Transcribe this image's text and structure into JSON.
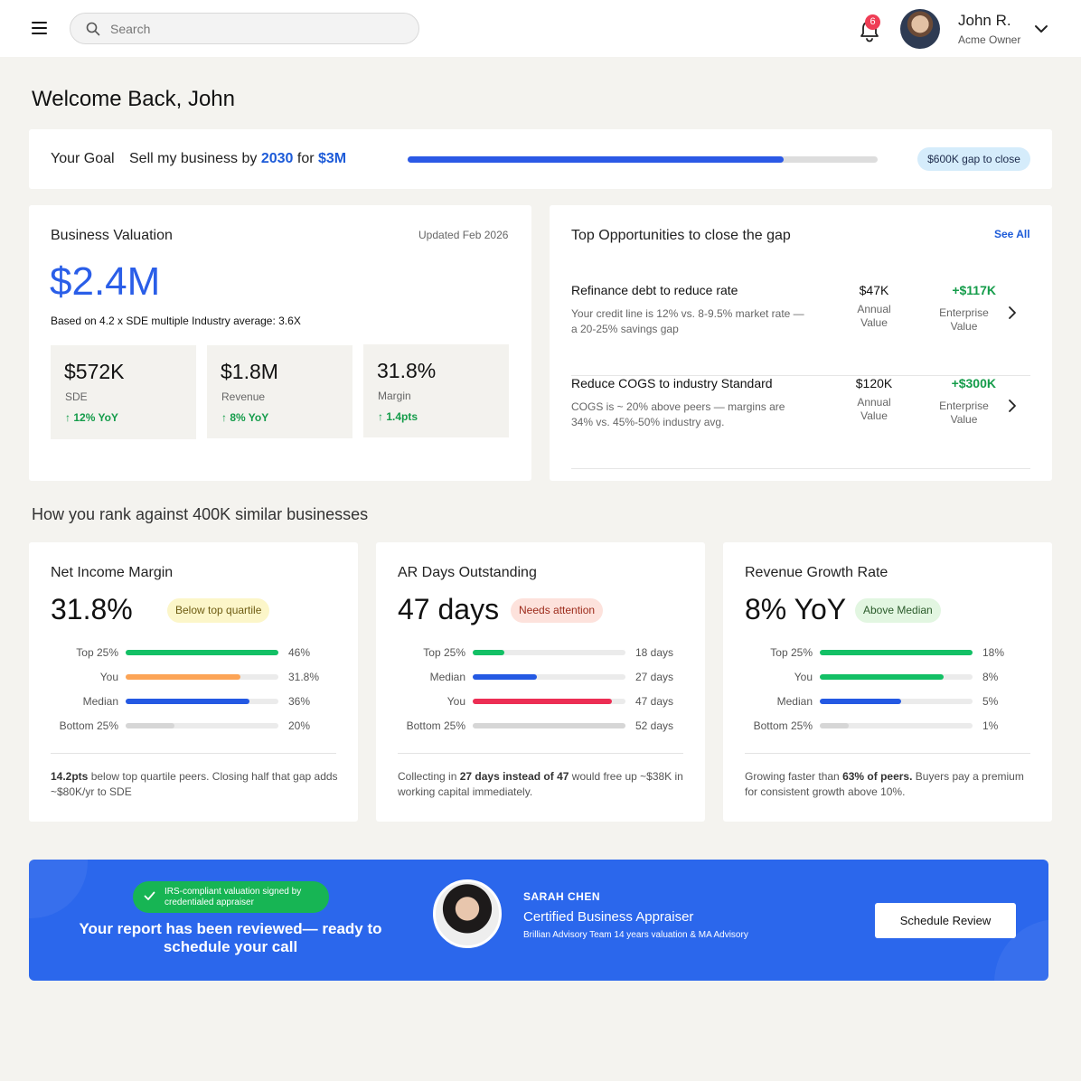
{
  "header": {
    "search_placeholder": "Search",
    "notification_count": "6",
    "user_name": "John R.",
    "user_role": "Acme Owner"
  },
  "welcome": "Welcome Back, John",
  "goal": {
    "label": "Your Goal",
    "text_prefix": "Sell my business by ",
    "year": "2030",
    "text_mid": " for ",
    "amount": "$3M",
    "progress_fraction": 0.8,
    "gap_badge": "$600K gap to close"
  },
  "valuation": {
    "title": "Business Valuation",
    "updated": "Updated Feb 2026",
    "amount": "$2.4M",
    "basis": "Based on 4.2 x SDE multiple Industry average: 3.6X",
    "metrics": [
      {
        "value": "$572K",
        "label": "SDE",
        "change": "12% YoY"
      },
      {
        "value": "$1.8M",
        "label": "Revenue",
        "change": "8% YoY"
      },
      {
        "value": "31.8%",
        "label": "Margin",
        "change": "1.4pts"
      }
    ]
  },
  "opportunities": {
    "title": "Top Opportunities to close the gap",
    "see_all": "See All",
    "items": [
      {
        "title": "Refinance debt to reduce rate",
        "desc": "Your credit line is 12% vs. 8-9.5% market rate — a 20-25% savings gap",
        "annual": "$47K",
        "annual_label": "Annual Value",
        "enterprise": "+$117K",
        "enterprise_label": "Enterprise Value"
      },
      {
        "title": "Reduce COGS to industry Standard",
        "desc": "COGS is ~ 20% above peers — margins are 34% vs. 45%-50% industry avg.",
        "annual": "$120K",
        "annual_label": "Annual Value",
        "enterprise": "+$300K",
        "enterprise_label": "Enterprise Value"
      }
    ]
  },
  "rank_heading": "How you rank against 400K similar businesses",
  "benchmarks": [
    {
      "title": "Net Income Margin",
      "value": "31.8%",
      "tag": "Below top quartile",
      "tag_color": "#fcf6c9",
      "tag_text_color": "#6e5c12",
      "rows": [
        {
          "label": "Top 25%",
          "value": "46%",
          "fraction": 1.0,
          "color": "#13c065"
        },
        {
          "label": "You",
          "value": "31.8%",
          "fraction": 0.75,
          "color": "#fca456"
        },
        {
          "label": "Median",
          "value": "36%",
          "fraction": 0.81,
          "color": "#2459e3"
        },
        {
          "label": "Bottom 25%",
          "value": "20%",
          "fraction": 0.32,
          "color": "#d6d6d6"
        }
      ],
      "note_bold": "14.2pts",
      "note_rest": " below top quartile peers. Closing half that gap adds ~$80K/yr to SDE"
    },
    {
      "title": "AR Days Outstanding",
      "value": "47 days",
      "tag": "Needs attention",
      "tag_color": "#fde2dc",
      "tag_text_color": "#9c2a1a",
      "rows": [
        {
          "label": "Top 25%",
          "value": "18 days",
          "fraction": 0.21,
          "color": "#13c065"
        },
        {
          "label": "Median",
          "value": "27 days",
          "fraction": 0.42,
          "color": "#2459e3"
        },
        {
          "label": "You",
          "value": "47 days",
          "fraction": 0.91,
          "color": "#ec2e54"
        },
        {
          "label": "Bottom 25%",
          "value": "52 days",
          "fraction": 1.0,
          "color": "#d6d6d6"
        }
      ],
      "note_pre": "Collecting in ",
      "note_bold": "27 days instead of 47",
      "note_rest": " would free up ~$38K in working capital immediately."
    },
    {
      "title": "Revenue Growth Rate",
      "value": "8% YoY",
      "tag": "Above Median",
      "tag_color": "#e2f6e1",
      "tag_text_color": "#2a5a2a",
      "rows": [
        {
          "label": "Top 25%",
          "value": "18%",
          "fraction": 1.0,
          "color": "#13c065"
        },
        {
          "label": "You",
          "value": "8%",
          "fraction": 0.81,
          "color": "#13c065"
        },
        {
          "label": "Median",
          "value": "5%",
          "fraction": 0.53,
          "color": "#2459e3"
        },
        {
          "label": "Bottom 25%",
          "value": "1%",
          "fraction": 0.19,
          "color": "#d6d6d6"
        }
      ],
      "note_pre": "Growing faster than ",
      "note_bold": "63% of peers.",
      "note_rest": " Buyers pay a premium for consistent growth above 10%."
    }
  ],
  "banner": {
    "pill": "IRS-compliant valuation signed by credentialed appraiser",
    "message": "Your report has been reviewed— ready to schedule your call",
    "appraiser_name": "SARAH CHEN",
    "appraiser_role": "Certified Business Appraiser",
    "appraiser_team": "Brillian Advisory Team 14 years valuation & MA Advisory",
    "button": "Schedule Review"
  }
}
